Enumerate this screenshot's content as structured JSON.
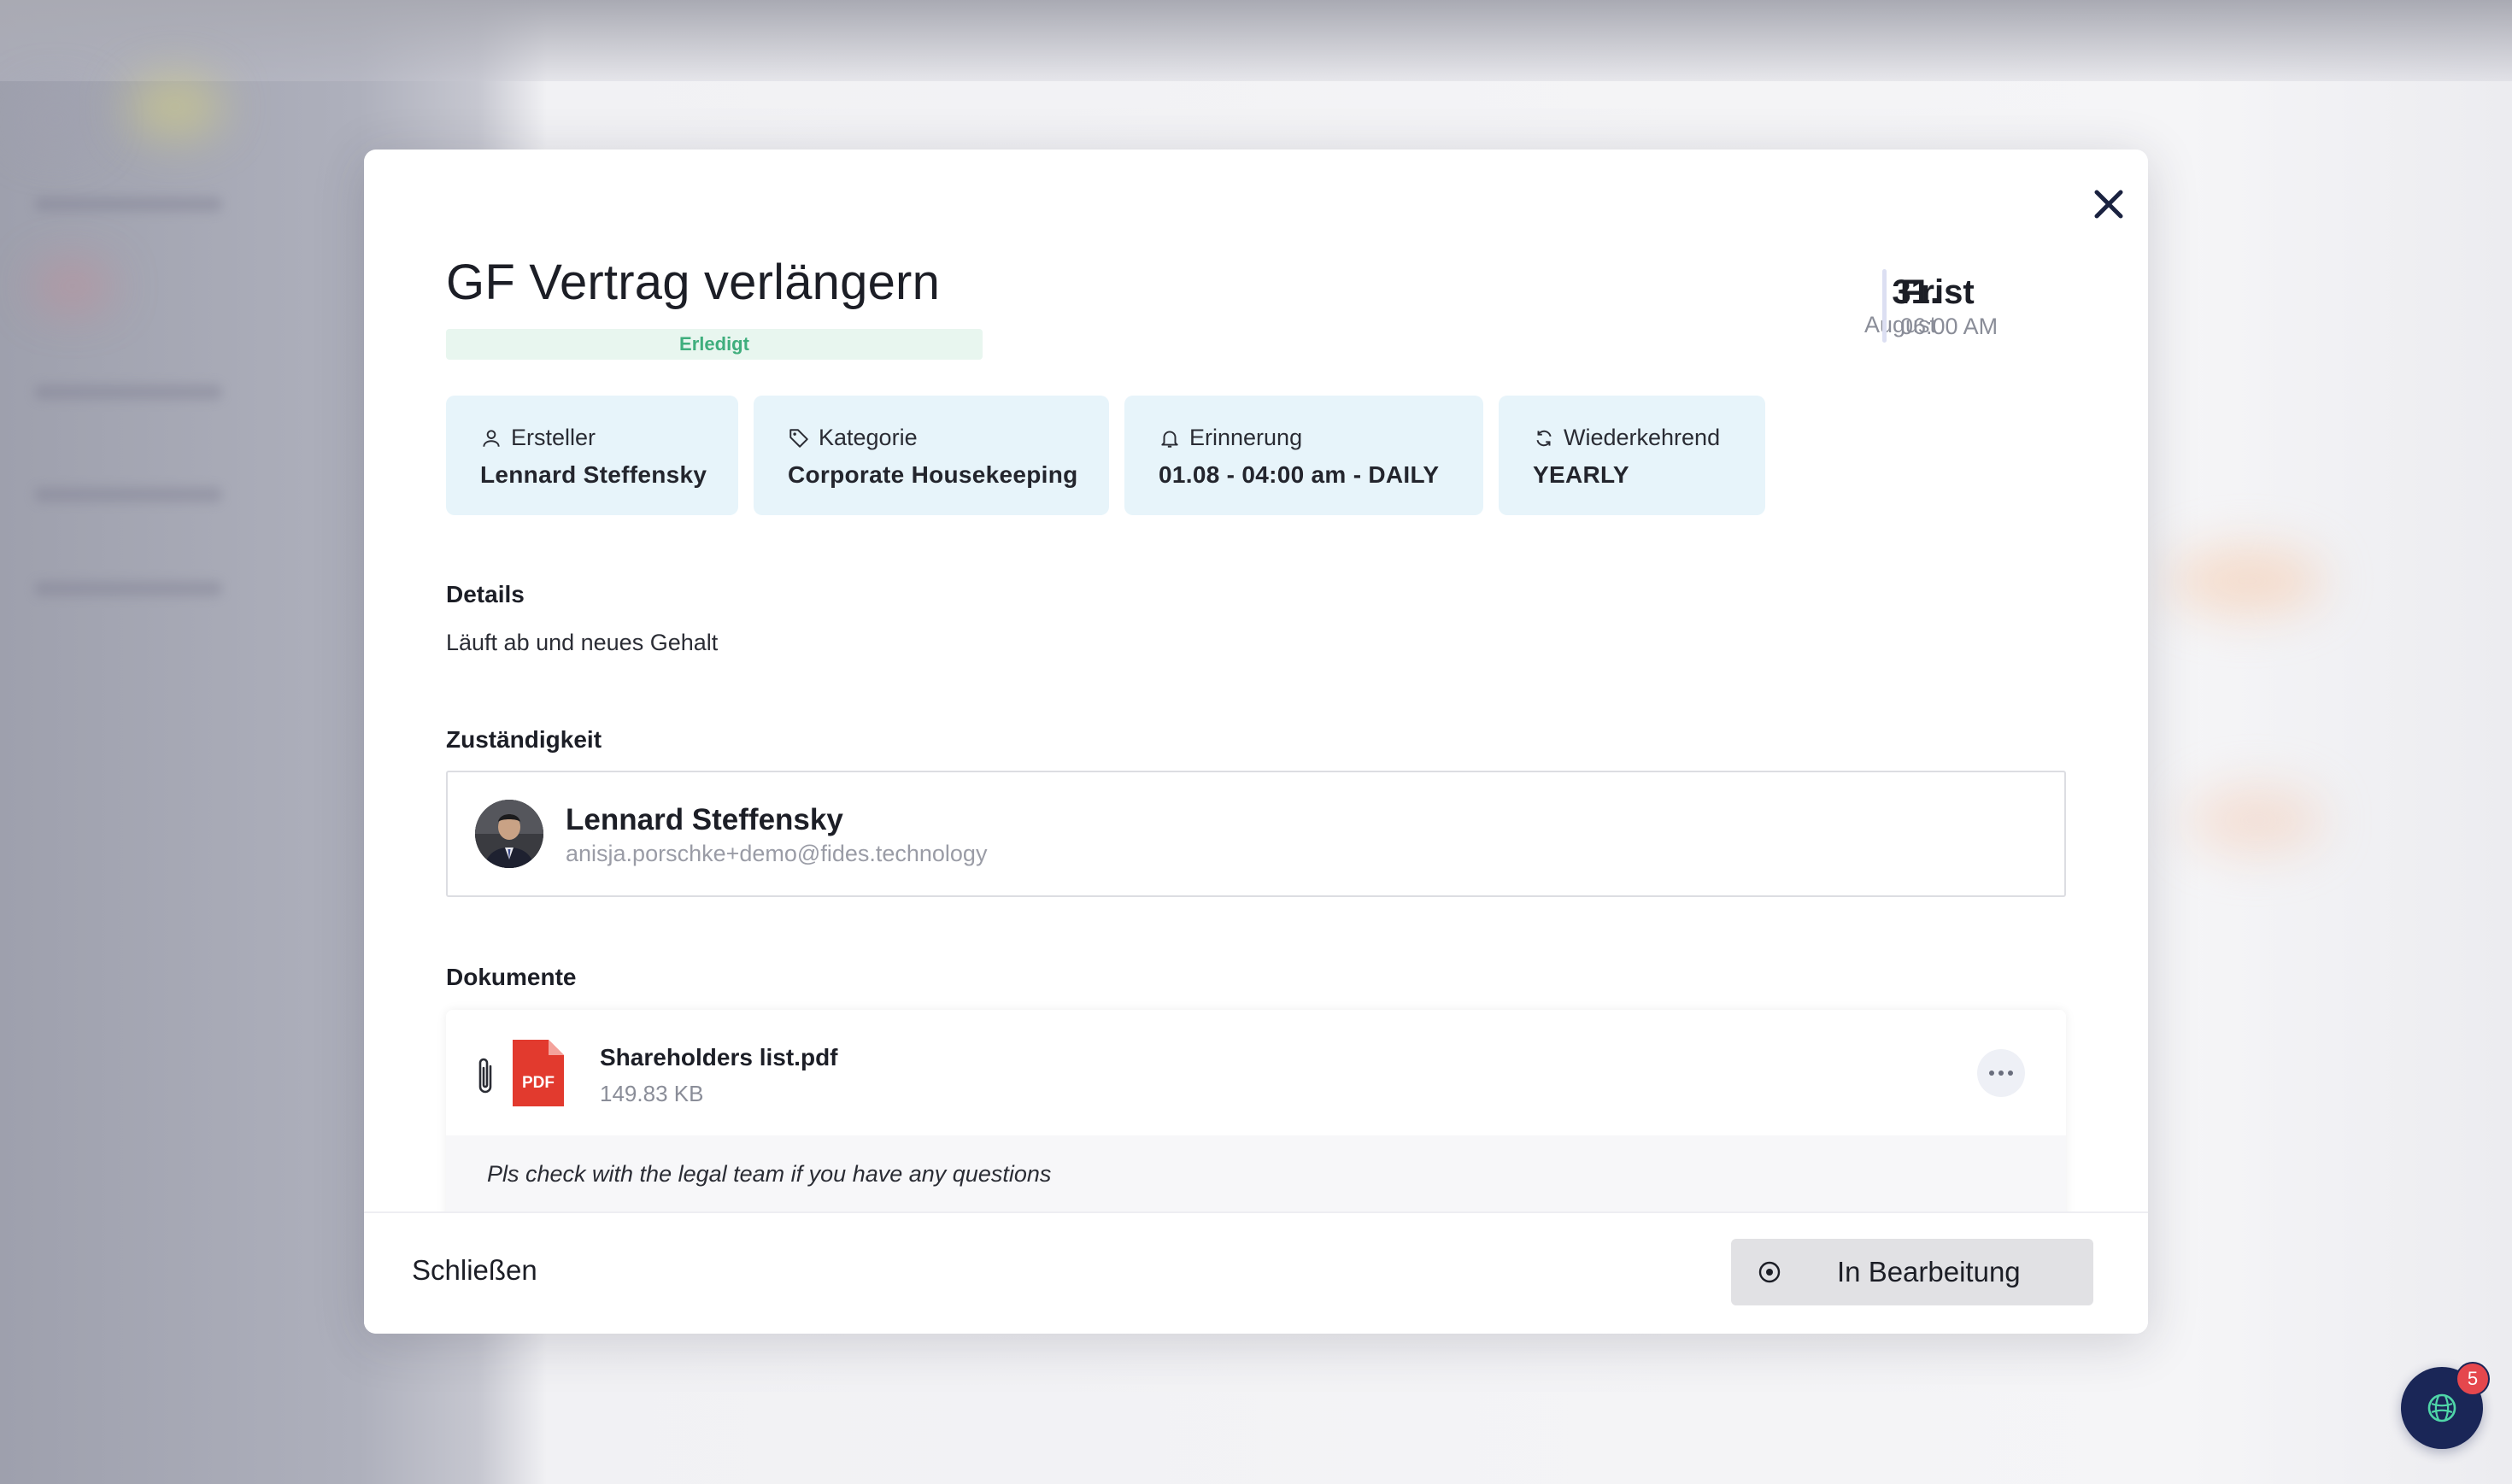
{
  "task": {
    "title": "GF Vertrag verlängern",
    "status": "Erledigt",
    "deadline": {
      "day": "31.",
      "month": "August",
      "label": "Frist",
      "time": "06:00 AM"
    }
  },
  "chips": [
    {
      "label": "Ersteller",
      "value": "Lennard Steffensky",
      "icon": "user-icon"
    },
    {
      "label": "Kategorie",
      "value": "Corporate Housekeeping",
      "icon": "tag-icon"
    },
    {
      "label": "Erinnerung",
      "value": "01.08 - 04:00 am - DAILY",
      "icon": "bell-icon"
    },
    {
      "label": "Wiederkehrend",
      "value": "YEARLY",
      "icon": "repeat-icon"
    }
  ],
  "details": {
    "heading": "Details",
    "text": "Läuft ab und neues Gehalt"
  },
  "responsibility": {
    "heading": "Zuständigkeit",
    "name": "Lennard Steffensky",
    "email": "anisja.porschke+demo@fides.technology"
  },
  "documents": {
    "heading": "Dokumente",
    "items": [
      {
        "name": "Shareholders list.pdf",
        "size": "149.83 KB",
        "type": "PDF",
        "note": "Pls check with the legal team if you have any questions"
      }
    ]
  },
  "footer": {
    "close_label": "Schließen",
    "status_button_label": "In Bearbeitung"
  },
  "chat": {
    "badge_count": "5"
  },
  "colors": {
    "accent_status": "#3fae7d",
    "chip_bg": "#e7f4fa",
    "pdf_red": "#e23a2e",
    "chat_bg": "#1a2657",
    "badge_red": "#e5474d"
  }
}
